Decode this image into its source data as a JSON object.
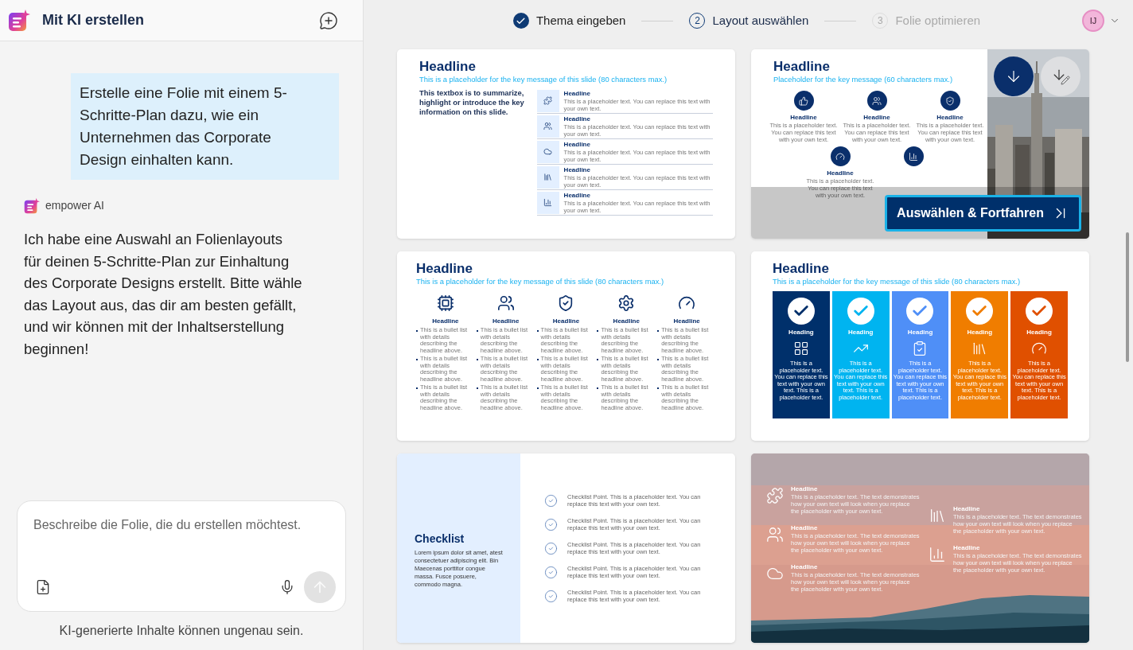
{
  "sidebar": {
    "title": "Mit KI erstellen",
    "user_message": "Erstelle eine Folie mit einem 5-Schritte-Plan dazu, wie ein Unternehmen das Corporate Design einhalten kann.",
    "assistant": {
      "name": "empower AI",
      "message": "Ich habe eine Auswahl an Folienlayouts für deinen 5-Schritte-Plan zur Einhaltung des Corporate Designs erstellt. Bitte wähle das Layout aus, das dir am besten gefällt, und wir können mit der Inhaltserstellung beginnen!"
    },
    "composer": {
      "placeholder": "Beschreibe die Folie, die du erstellen möchtest."
    },
    "disclaimer": "KI-generierte Inhalte können ungenau sein."
  },
  "stepper": [
    {
      "label": "Thema eingeben",
      "done": true,
      "selected": false
    },
    {
      "number": "2",
      "label": "Layout auswählen",
      "done": false,
      "selected": true
    },
    {
      "number": "3",
      "label": "Folie optimieren",
      "done": false,
      "selected": false
    }
  ],
  "user": {
    "initials": "IJ"
  },
  "slides": [
    {
      "kind": "icon-list",
      "hovered": false,
      "headline": "Headline",
      "subtitle": "This is a placeholder for the key message of this slide (80 characters max.)",
      "summary": "This textbox is to summarize, highlight or introduce the key information on this slide.",
      "items": [
        {
          "headline": "Headline",
          "text": "This is a placeholder text. You can replace this text with your own text."
        },
        {
          "headline": "Headline",
          "text": "This is a placeholder text. You can replace this text with your own text."
        },
        {
          "headline": "Headline",
          "text": "This is a placeholder text. You can replace this text with your own text."
        },
        {
          "headline": "Headline",
          "text": "This is a placeholder text. You can replace this text with your own text."
        },
        {
          "headline": "Headline",
          "text": "This is a placeholder text. You can replace this text with your own text."
        }
      ]
    },
    {
      "kind": "icon-grid-photo",
      "hovered": true,
      "select_label": "Auswählen & Fortfahren",
      "headline": "Headline",
      "subtitle": "Placeholder for the key message (60 characters max.)",
      "items": [
        {
          "kind": "full",
          "headline": "Headline",
          "text": "This is a placeholder text. You can replace this text with your own text."
        },
        {
          "kind": "full",
          "headline": "Headline",
          "text": "This is a placeholder text. You can replace this text with your own text."
        },
        {
          "kind": "full",
          "headline": "Headline",
          "text": "This is a placeholder text. You can replace this text with your own text."
        },
        {
          "kind": "full",
          "headline": "Headline",
          "text": "This is a placeholder text. You can replace this text with your own text."
        },
        {
          "kind": "icon-only"
        }
      ]
    },
    {
      "kind": "icon-columns",
      "hovered": false,
      "headline": "Headline",
      "subtitle": "This is a placeholder for the key message of this slide (80 characters max.)",
      "items": [
        {
          "headline": "Headline",
          "bullets": [
            "This is a bullet list with details describing the headline above.",
            "This is a bullet list with details describing the headline above.",
            "This is a bullet list with details describing the headline above."
          ]
        },
        {
          "headline": "Headline",
          "bullets": [
            "This is a bullet list with details describing the headline above.",
            "This is a bullet list with details describing the headline above.",
            "This is a bullet list with details describing the headline above."
          ]
        },
        {
          "headline": "Headline",
          "bullets": [
            "This is a bullet list with details describing the headline above.",
            "This is a bullet list with details describing the headline above.",
            "This is a bullet list with details describing the headline above."
          ]
        },
        {
          "headline": "Headline",
          "bullets": [
            "This is a bullet list with details describing the headline above.",
            "This is a bullet list with details describing the headline above.",
            "This is a bullet list with details describing the headline above."
          ]
        },
        {
          "headline": "Headline",
          "bullets": [
            "This is a bullet list with details describing the headline above.",
            "This is a bullet list with details describing the headline above.",
            "This is a bullet list with details describing the headline above."
          ]
        }
      ]
    },
    {
      "kind": "color-columns",
      "hovered": false,
      "headline": "Headline",
      "subtitle": "This is a placeholder for the key message of this slide (80 characters max.)",
      "items": [
        {
          "heading": "Heading",
          "color": "#00306b",
          "text": "This is a placeholder text. You can replace this text with your own text. This is a placeholder text."
        },
        {
          "heading": "Heading",
          "color": "#00b4f0",
          "text": "This is a placeholder text. You can replace this text with your own text. This is a placeholder text."
        },
        {
          "heading": "Heading",
          "color": "#4f8ff7",
          "text": "This is a placeholder text. You can replace this text with your own text. This is a placeholder text."
        },
        {
          "heading": "Heading",
          "color": "#f07d00",
          "text": "This is a placeholder text. You can replace this text with your own text. This is a placeholder text."
        },
        {
          "heading": "Heading",
          "color": "#e05000",
          "text": "This is a placeholder text. You can replace this text with your own text. This is a placeholder text."
        }
      ]
    },
    {
      "kind": "checklist",
      "hovered": false,
      "title": "Checklist",
      "body": "Lorem ipsum dolor sit amet, atest consectetuer adipiscing elit. Bin Maecenas porttitor congue massa. Fusce posuere, commodo magna.",
      "points": [
        "Checklist Point. This is a placeholder text. You can replace this text with your own text.",
        "Checklist Point. This is a placeholder text. You can replace this text with your own text.",
        "Checklist Point. This is a placeholder text. You can replace this text with your own text.",
        "Checklist Point. This is a placeholder text. You can replace this text with your own text.",
        "Checklist Point. This is a placeholder text. You can replace this text with your own text."
      ]
    },
    {
      "kind": "photo-overlay",
      "hovered": false,
      "items": [
        {
          "headline": "Headline",
          "text": "This is a placeholder text. The text demonstrates how your own text will look when you replace the placeholder with your own text."
        },
        {
          "headline": "Headline",
          "text": "This is a placeholder text. The text demonstrates how your own text will look when you replace the placeholder with your own text."
        },
        {
          "headline": "Headline",
          "text": "This is a placeholder text. The text demonstrates how your own text will look when you replace the placeholder with your own text."
        },
        {
          "headline": "Headline",
          "text": "This is a placeholder text. The text demonstrates how your own text will look when you replace the placeholder with your own text."
        },
        {
          "headline": "Headline",
          "text": "This is a placeholder text. The text demonstrates how your own text will look when you replace the placeholder with your own text."
        }
      ]
    }
  ]
}
